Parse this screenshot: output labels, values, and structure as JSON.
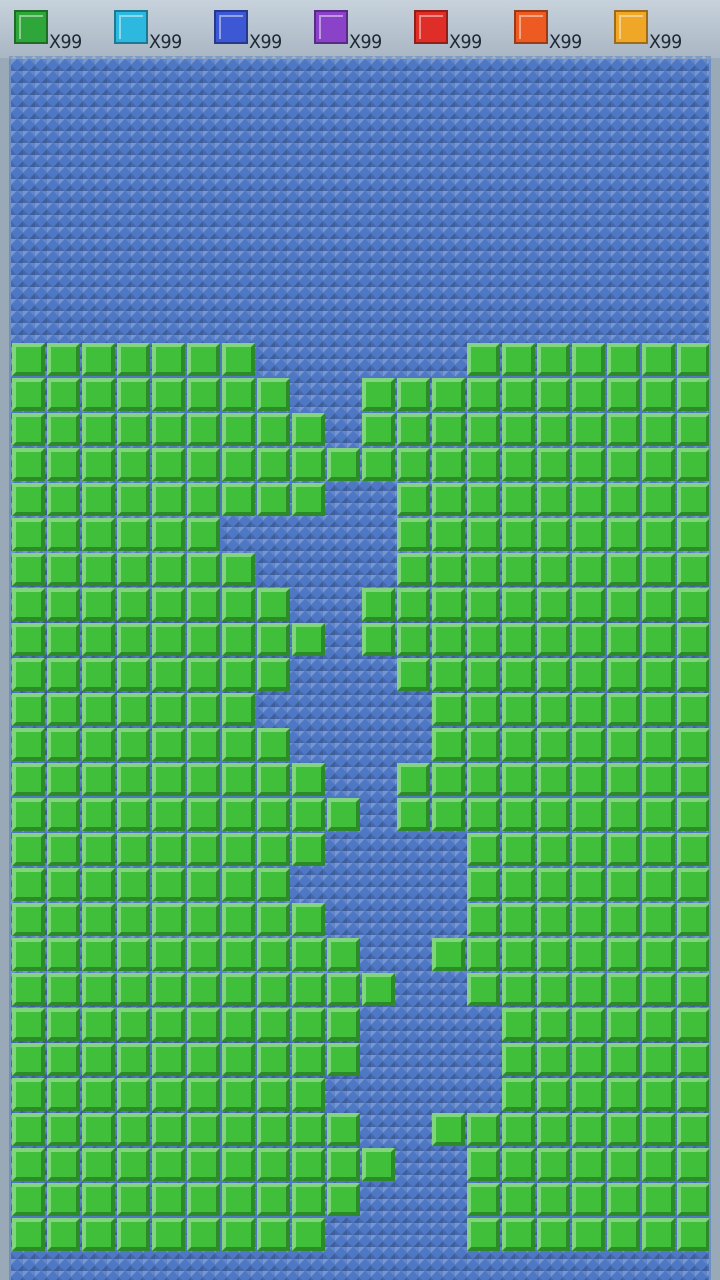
{
  "counters": [
    {
      "color": "#2fa63a",
      "icon": "green-block-icon",
      "label": "X99"
    },
    {
      "color": "#2db8e0",
      "icon": "cyan-block-icon",
      "label": "X99"
    },
    {
      "color": "#3d58d4",
      "icon": "blue-block-icon",
      "label": "X99"
    },
    {
      "color": "#8a43c8",
      "icon": "purple-block-icon",
      "label": "X99"
    },
    {
      "color": "#de2e27",
      "icon": "red-block-icon",
      "label": "X99"
    },
    {
      "color": "#ee5b22",
      "icon": "orange-block-icon",
      "label": "X99"
    },
    {
      "color": "#f0a626",
      "icon": "yellow-block-icon",
      "label": "X99"
    }
  ],
  "board": {
    "block_color": "#3fbf3a",
    "board_color": "#4f78c4",
    "columns": 20,
    "rows": 26,
    "gap_rows": [
      [
        7,
        12
      ],
      [
        8,
        9
      ],
      [
        9,
        9
      ],
      [
        10,
        9
      ],
      [
        9,
        10
      ],
      [
        6,
        10
      ],
      [
        7,
        10
      ],
      [
        8,
        9
      ],
      [
        9,
        9
      ],
      [
        8,
        10
      ],
      [
        7,
        11
      ],
      [
        8,
        11
      ],
      [
        9,
        10
      ],
      [
        10,
        10
      ],
      [
        9,
        12
      ],
      [
        8,
        12
      ],
      [
        9,
        12
      ],
      [
        10,
        11
      ],
      [
        11,
        12
      ],
      [
        10,
        13
      ],
      [
        10,
        13
      ],
      [
        9,
        13
      ],
      [
        10,
        11
      ],
      [
        11,
        12
      ],
      [
        10,
        12
      ],
      [
        9,
        12
      ]
    ]
  }
}
